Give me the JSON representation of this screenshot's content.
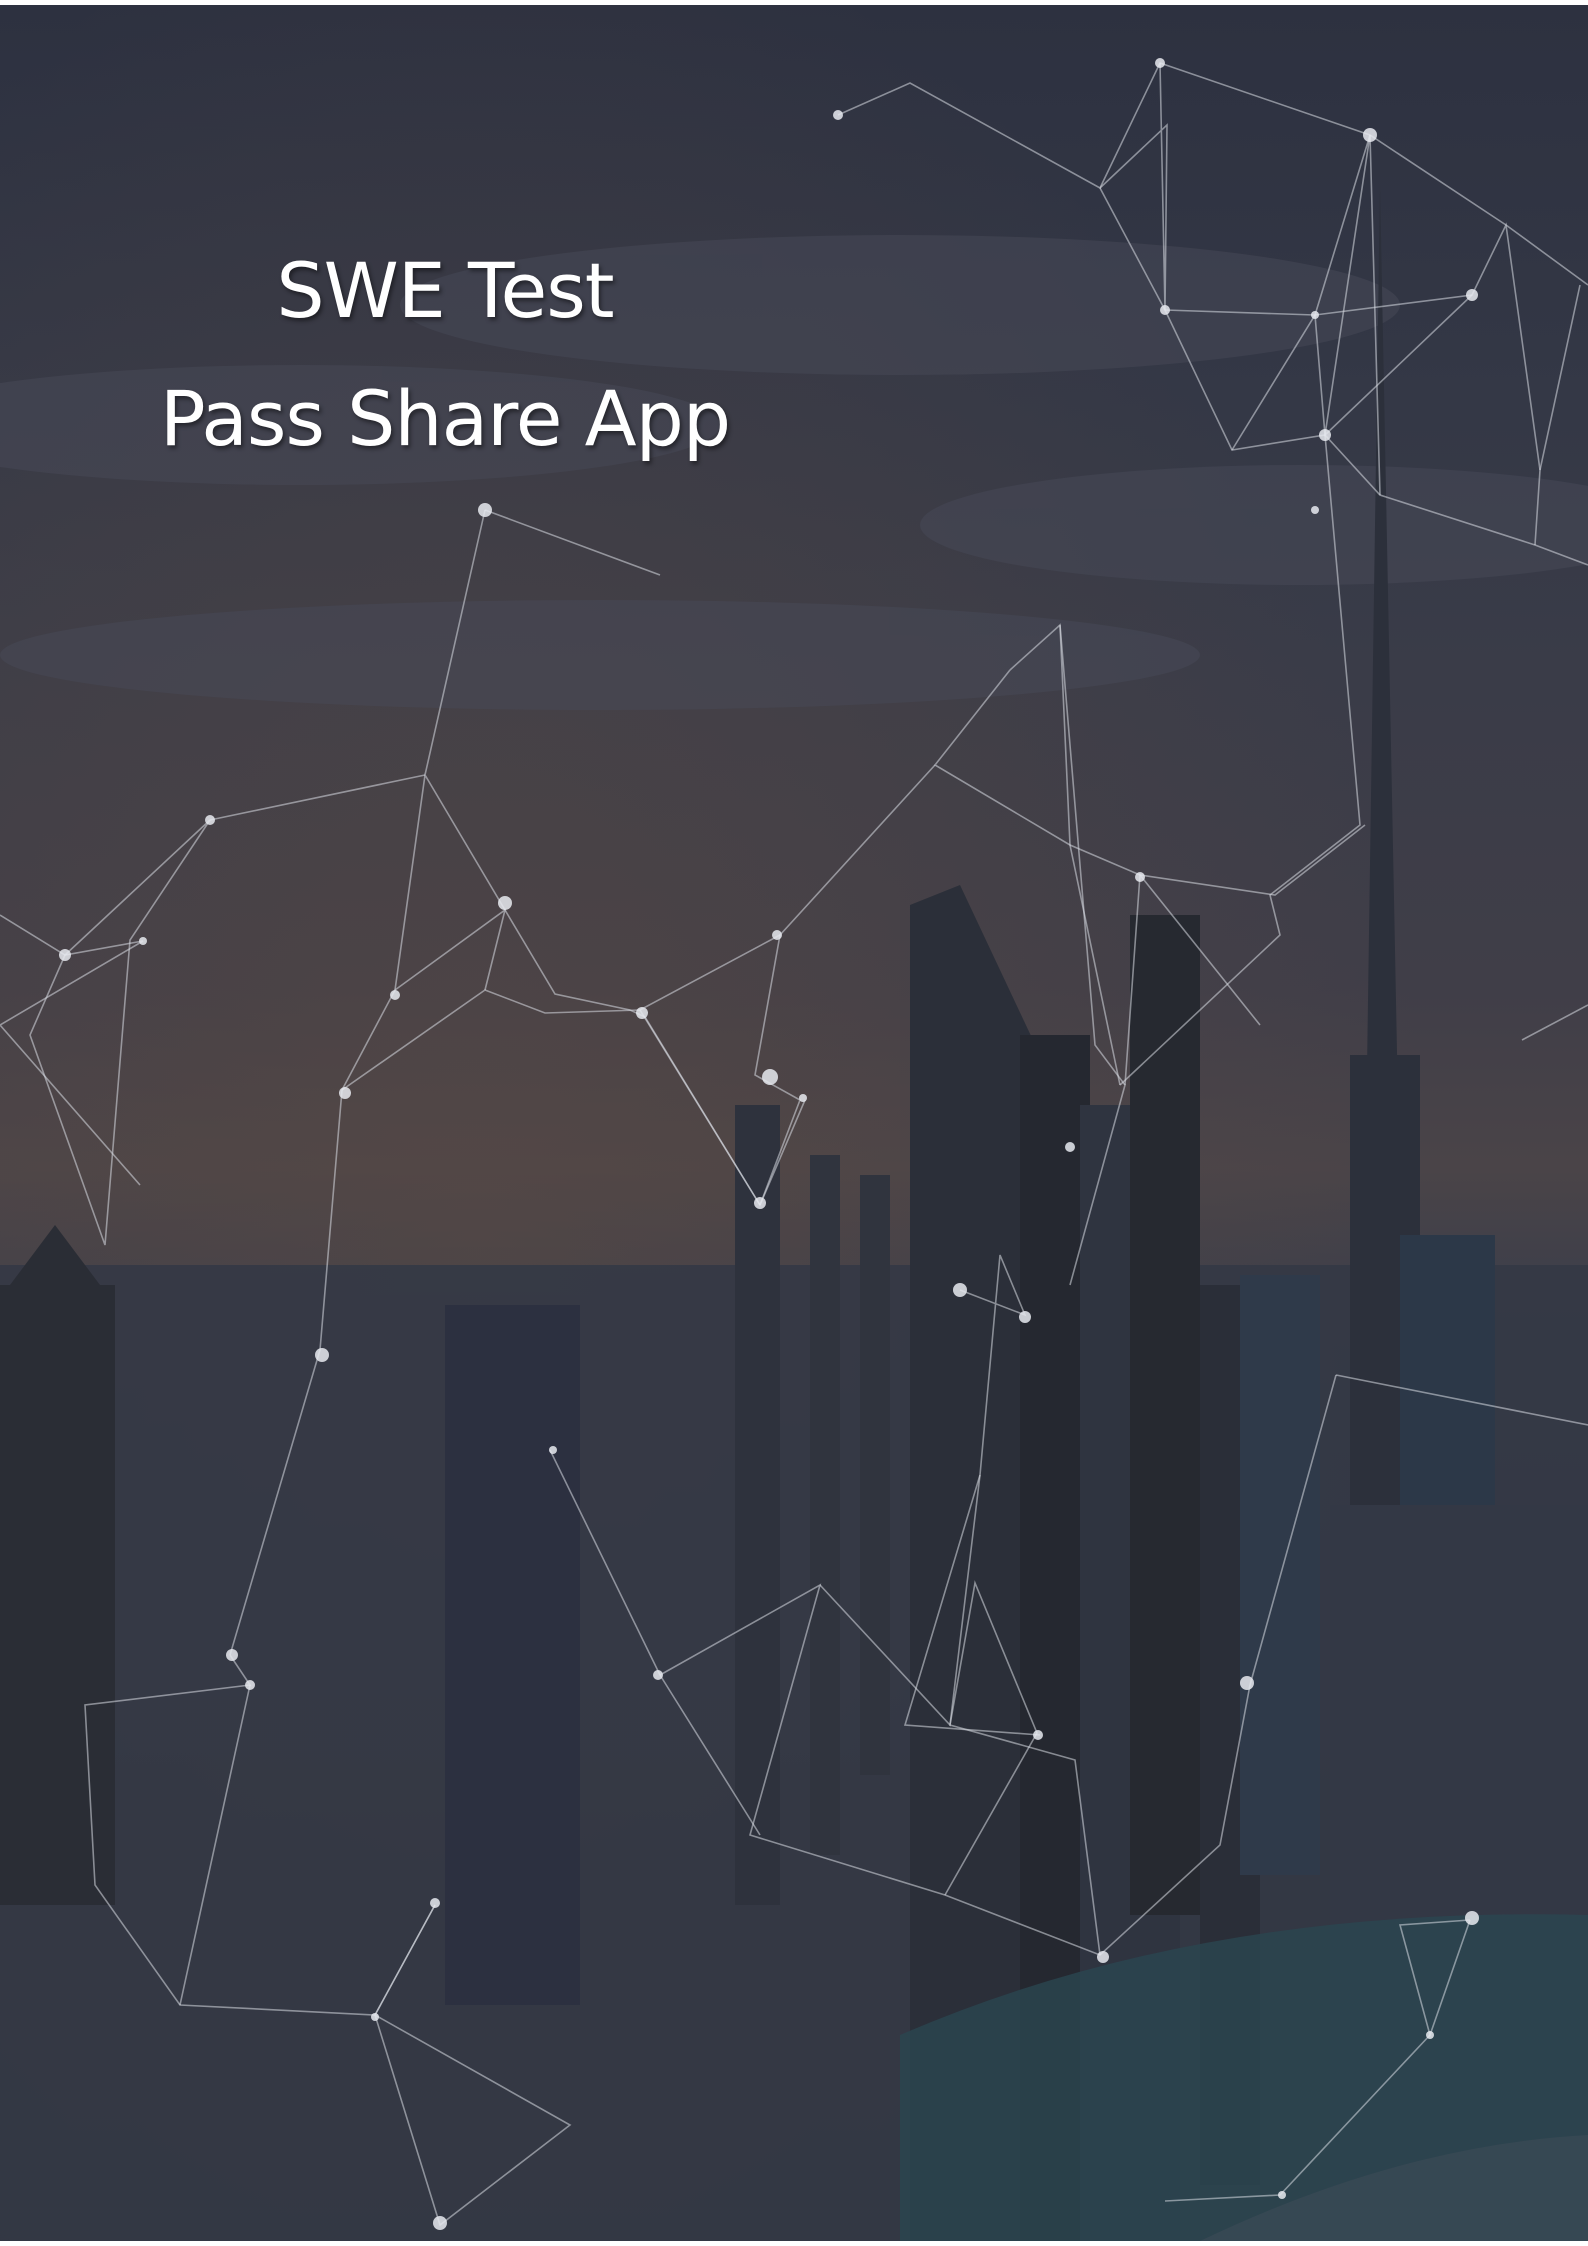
{
  "cover": {
    "title_line_1": "SWE Test",
    "title_line_2": "Pass Share App"
  },
  "colors": {
    "background_dark": "#2d3140",
    "horizon_glow": "#4a4448",
    "title_text": "#ffffff",
    "network_lines": "#d9dce4"
  }
}
